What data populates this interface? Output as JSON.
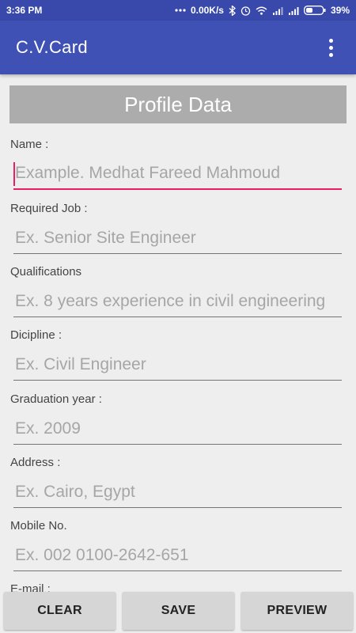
{
  "status_bar": {
    "time": "3:36 PM",
    "network_speed": "0.00K/s",
    "battery": "39%",
    "icons": [
      "dots-icon",
      "bluetooth-icon",
      "alarm-icon",
      "wifi-icon",
      "signal-icon",
      "signal-icon",
      "battery-icon"
    ]
  },
  "app_bar": {
    "title": "C.V.Card",
    "menu_icon": "overflow-menu-icon"
  },
  "header": {
    "title": "Profile Data"
  },
  "fields": [
    {
      "label": "Name :",
      "placeholder": "Example. Medhat Fareed Mahmoud",
      "focused": true
    },
    {
      "label": "Required Job :",
      "placeholder": "Ex. Senior Site Engineer"
    },
    {
      "label": "Qualifications",
      "placeholder": "Ex. 8 years experience in civil engineering"
    },
    {
      "label": "Dicipline :",
      "placeholder": "Ex. Civil Engineer"
    },
    {
      "label": "Graduation year :",
      "placeholder": "Ex. 2009"
    },
    {
      "label": "Address :",
      "placeholder": "Ex. Cairo, Egypt"
    },
    {
      "label": "Mobile No.",
      "placeholder": "Ex. 002 0100-2642-651"
    },
    {
      "label": "E-mail :",
      "placeholder": ""
    }
  ],
  "buttons": {
    "clear": "CLEAR",
    "save": "SAVE",
    "preview": "PREVIEW"
  },
  "colors": {
    "primary": "#3f51b5",
    "primary_dark": "#3949ab",
    "accent": "#e91e63",
    "header_bg": "#acacac"
  }
}
